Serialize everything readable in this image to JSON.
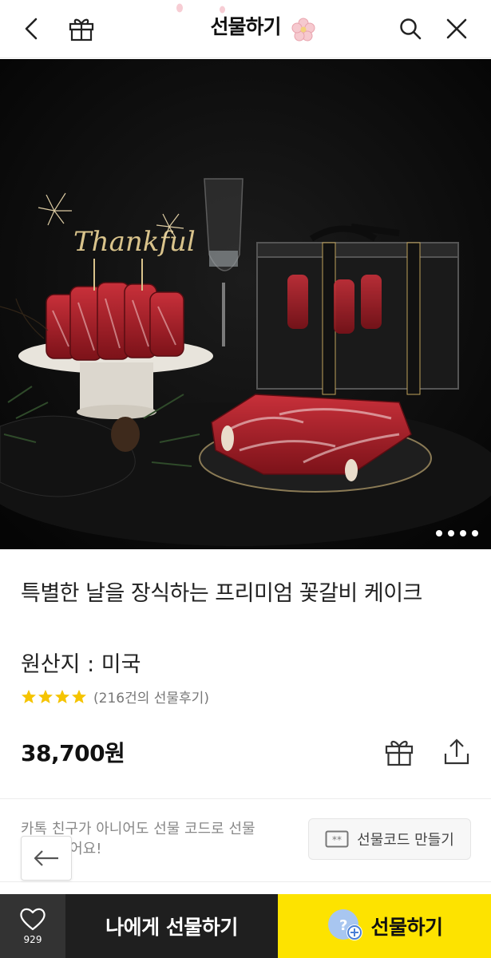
{
  "header": {
    "title": "선물하기"
  },
  "hero": {
    "image_caption": "Thankful",
    "page_indicator_count": 4,
    "active_index": 0
  },
  "product": {
    "title": "특별한 날을 장식하는 프리미엄 꽃갈비 케이크",
    "origin": "원산지 : 미국",
    "rating_stars": 4,
    "review_text": "(216건의 선물후기)",
    "price": "38,700원"
  },
  "gift_code": {
    "description": "카톡 친구가 아니어도 선물 코드로 선물할 수 있어요!",
    "button_label": "선물코드 만들기"
  },
  "bottom_bar": {
    "like_count": "929",
    "self_gift_label": "나에게 선물하기",
    "gift_label": "선물하기"
  },
  "colors": {
    "accent": "#fde300",
    "star": "#f5c400",
    "dark_bar": "#1f1f1f"
  }
}
